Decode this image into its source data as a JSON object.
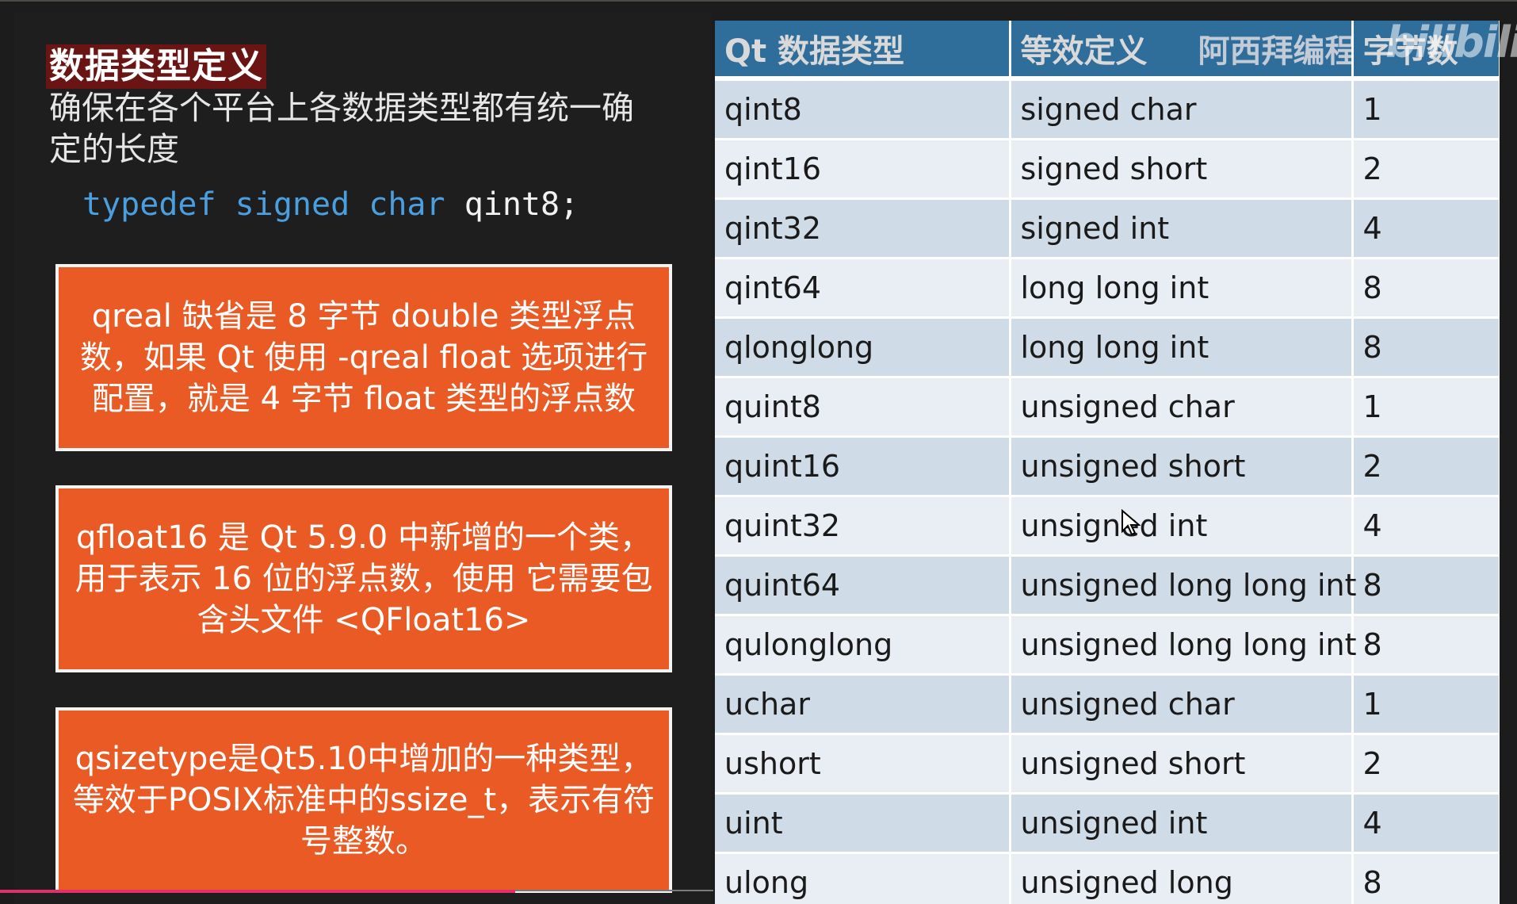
{
  "left": {
    "title": "数据类型定义",
    "description": "确保在各个平台上各数据类型都有统一确定的长度",
    "code": {
      "kw1": "typedef",
      "kw2": "signed",
      "kw3": "char",
      "ident": "qint8;"
    },
    "notes": [
      "qreal 缺省是 8 字节 double 类型浮点数，如果 Qt 使用 -qreal float 选项进行配置，就是 4 字节 float 类型的浮点数",
      "qfloat16 是 Qt 5.9.0 中新增的一个类，用于表示 16 位的浮点数，使用 它需要包含头文件 <QFloat16>",
      "qsizetype是Qt5.10中增加的一种类型，等效于POSIX标准中的ssize_t，表示有符号整数。"
    ]
  },
  "table": {
    "headers": [
      "Qt 数据类型",
      "等效定义",
      "字节数"
    ],
    "header_watermark": "阿西拜编程",
    "rows": [
      [
        "qint8",
        "signed char",
        "1"
      ],
      [
        "qint16",
        "signed short",
        "2"
      ],
      [
        "qint32",
        "signed int",
        "4"
      ],
      [
        "qint64",
        "long long int",
        "8"
      ],
      [
        "qlonglong",
        "long long int",
        "8"
      ],
      [
        "quint8",
        "unsigned char",
        "1"
      ],
      [
        "quint16",
        "unsigned short",
        "2"
      ],
      [
        "quint32",
        "unsigned int",
        "4"
      ],
      [
        "quint64",
        "unsigned long long int",
        "8"
      ],
      [
        "qulonglong",
        "unsigned long long int",
        "8"
      ],
      [
        "uchar",
        "unsigned char",
        "1"
      ],
      [
        "ushort",
        "unsigned short",
        "2"
      ],
      [
        "uint",
        "unsigned int",
        "4"
      ],
      [
        "ulong",
        "unsigned long",
        "8"
      ]
    ]
  },
  "watermark": "bilibili",
  "colors": {
    "background": "#1c1c1c",
    "title_highlight": "#6a1414",
    "note_fill": "#ea5a24",
    "table_header": "#2f6d9b",
    "row_odd": "#cfdbe7",
    "row_even": "#e9eef4",
    "code_keyword": "#4a9fe0"
  }
}
